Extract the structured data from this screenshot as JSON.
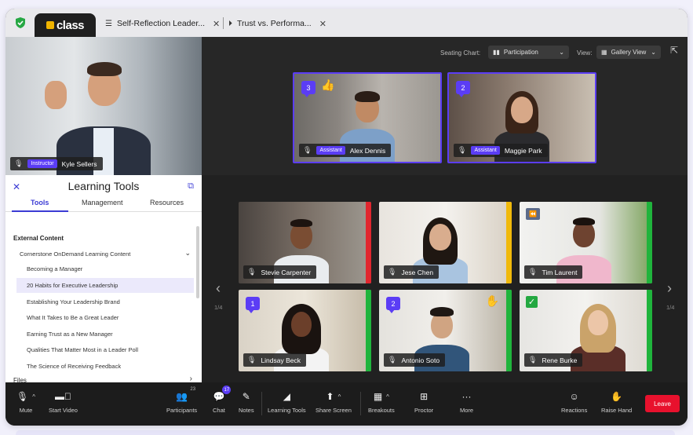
{
  "browser": {
    "logo": "class",
    "tabs": [
      {
        "title": "Self-Reflection Leader...",
        "icon": "list-icon"
      },
      {
        "title": "Trust vs. Performa...",
        "icon": "play-circle-icon"
      }
    ]
  },
  "view_controls": {
    "seating_label": "Seating Chart:",
    "seating_value": "Participation",
    "view_label": "View:",
    "view_value": "Gallery View"
  },
  "instructor": {
    "role": "Instructor",
    "name": "Kyle Sellers"
  },
  "spotlight": [
    {
      "number": "3",
      "role": "Assistant",
      "name": "Alex Dennis",
      "reaction": "👍"
    },
    {
      "number": "2",
      "role": "Assistant",
      "name": "Maggie Park"
    }
  ],
  "gallery": {
    "page_left": "1/4",
    "page_right": "1/4",
    "tiles": [
      {
        "name": "Stevie Carpenter",
        "status": "red"
      },
      {
        "name": "Jese Chen",
        "status": "yellow"
      },
      {
        "name": "Tim Laurent",
        "status": "green"
      },
      {
        "name": "Lindsay Beck",
        "number": "1",
        "status": "green"
      },
      {
        "name": "Antonio Soto",
        "number": "2",
        "status": "green"
      },
      {
        "name": "Rene Burke",
        "status": "green"
      }
    ]
  },
  "learning_tools": {
    "title": "Learning Tools",
    "tabs": [
      "Tools",
      "Management",
      "Resources"
    ],
    "active_tab": "Tools",
    "external_header": "External Content",
    "provider": "Cornerstone OnDemand Learning Content",
    "items": [
      "Becoming a Manager",
      "20 Habits for Executive Leadership",
      "Establishing Your Leadership Brand",
      "What It Takes to Be a Great Leader",
      "Earning Trust as a New Manager",
      "Qualities That Matter Most in a Leader Poll",
      "The Science of Receiving Feedback"
    ],
    "selected_index": 1,
    "files_label": "Files"
  },
  "toolbar": {
    "mute": "Mute",
    "start_video": "Start Video",
    "participants": "Participants",
    "participants_count": "23",
    "chat": "Chat",
    "chat_badge": "17",
    "notes": "Notes",
    "learning_tools": "Learning Tools",
    "share_screen": "Share Screen",
    "breakouts": "Breakouts",
    "proctor": "Proctor",
    "more": "More",
    "reactions": "Reactions",
    "raise_hand": "Raise Hand",
    "leave": "Leave"
  },
  "colors": {
    "accent": "#5b3df5",
    "status_red": "#e0262e",
    "status_yellow": "#f0b90b",
    "status_green": "#1fb43c",
    "leave": "#e8112d"
  }
}
